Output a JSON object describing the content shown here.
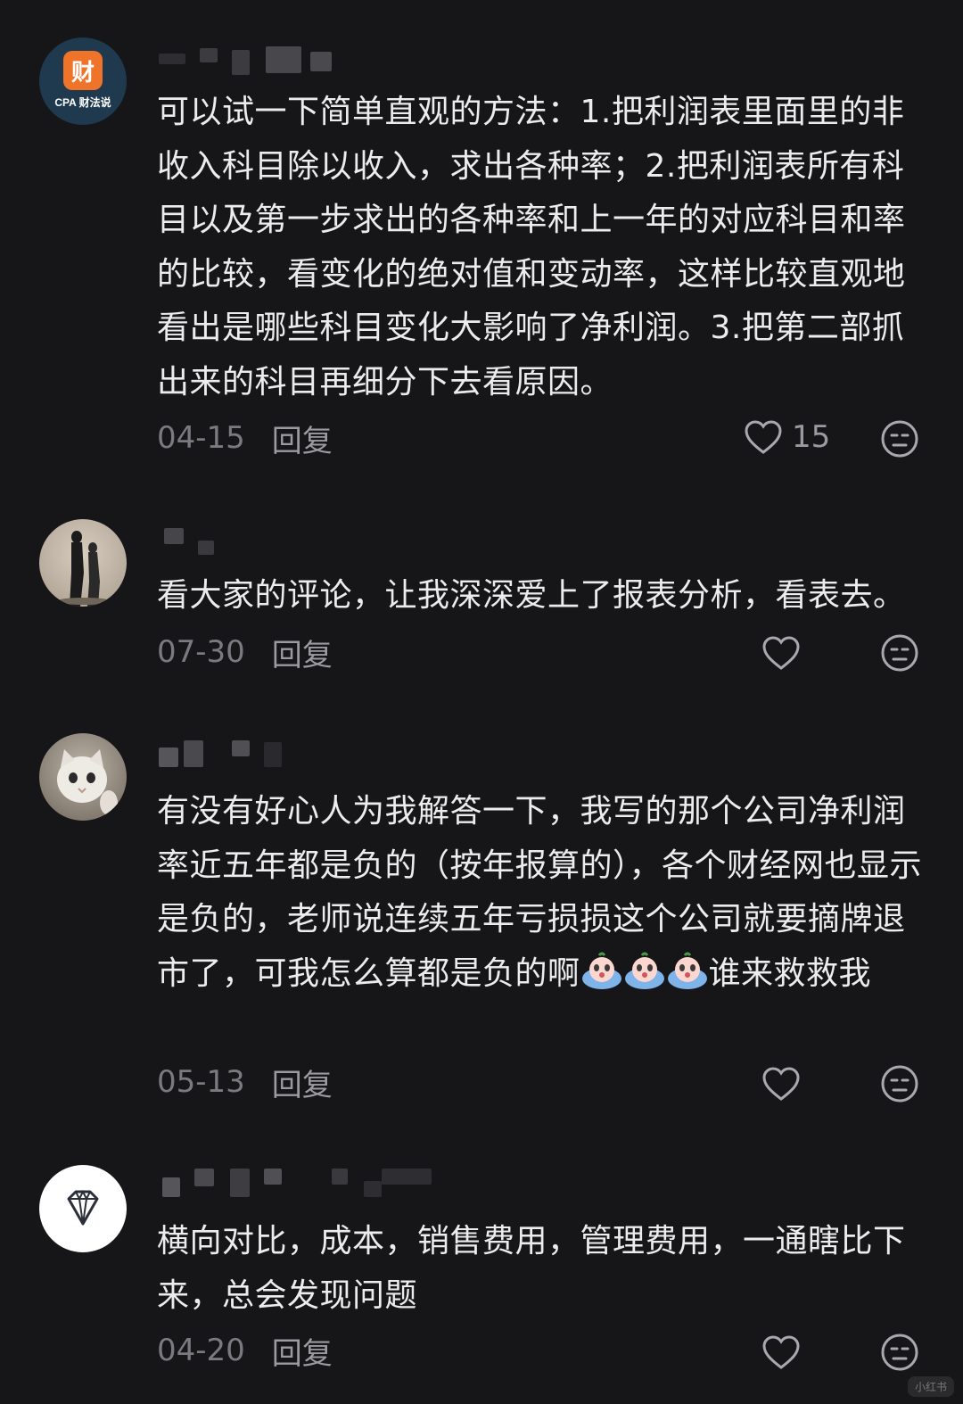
{
  "comments": [
    {
      "avatar": "cpa-logo-avatar",
      "avatar_label": "CPA 财法说",
      "avatar_glyph": "财",
      "text": "可以试一下简单直观的方法：1.把利润表里面里的非收入科目除以收入，求出各种率；2.把利润表所有科目以及第一步求出的各种率和上一年的对应科目和率的比较，看变化的绝对值和变动率，这样比较直观地看出是哪些科目变化大影响了净利润。3.把第二部抓出来的科目再细分下去看原因。",
      "date": "04-15",
      "reply": "回复",
      "likes": "15"
    },
    {
      "avatar": "silhouette-avatar",
      "text": "看大家的评论，让我深深爱上了报表分析，看表去。",
      "date": "07-30",
      "reply": "回复",
      "likes": ""
    },
    {
      "avatar": "cat-avatar",
      "text_before_emoji": "有没有好心人为我解答一下，我写的那个公司净利润率近五年都是负的（按年报算的），各个财经网也显示是负的，老师说连续五年亏损损这个公司就要摘牌退市了，可我怎么算都是负的啊",
      "emoji": "crying-emoji",
      "text_after_emoji": "谁来救救我",
      "date": "05-13",
      "reply": "回复",
      "likes": ""
    },
    {
      "avatar": "diamond-avatar",
      "text": "横向对比，成本，销售费用，管理费用，一通瞎比下来，总会发现问题",
      "date": "04-20",
      "reply": "回复",
      "likes": ""
    }
  ],
  "watermark": "小红书",
  "colors": {
    "background": "#161618",
    "text": "#ececee",
    "meta": "#7a7a80",
    "avatar_orange": "#f0732a",
    "avatar_navy": "#1f3a4f"
  }
}
